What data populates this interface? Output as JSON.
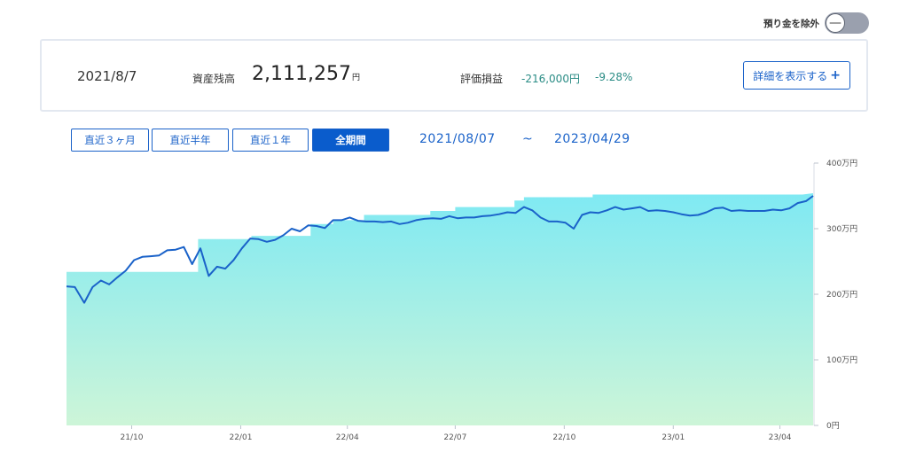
{
  "toggle": {
    "label": "預り金を除外",
    "state": "off",
    "knob_glyph": "—"
  },
  "summary": {
    "date": "2021/8/7",
    "balance_label": "資産残高",
    "balance_value": "2,111,257",
    "balance_unit": "円",
    "eval_label": "評価損益",
    "eval_amount": "-216,000円",
    "eval_percent": "-9.28%",
    "detail_button_label": "詳細を表示する",
    "detail_button_icon": "plus-icon"
  },
  "range_buttons": [
    {
      "label": "直近３ヶ月",
      "active": false
    },
    {
      "label": "直近半年",
      "active": false
    },
    {
      "label": "直近１年",
      "active": false
    },
    {
      "label": "全期間",
      "active": true
    }
  ],
  "period": {
    "start": "2021/08/07",
    "separator": "~",
    "end": "2023/04/29"
  },
  "colors": {
    "accent": "#0a5ccc",
    "line": "#1a62c9",
    "area_top": "#7fe9f3",
    "area_bottom": "#cdf5d8",
    "positive_text": "#2a8c85"
  },
  "chart_data": {
    "type": "area",
    "x_unit": "date",
    "y_ticks": [
      {
        "value": 0,
        "label": "0円"
      },
      {
        "value": 100,
        "label": "100万円"
      },
      {
        "value": 200,
        "label": "200万円"
      },
      {
        "value": 300,
        "label": "300万円"
      },
      {
        "value": 400,
        "label": "400万円"
      }
    ],
    "ylim": [
      0,
      400
    ],
    "x_ticks": [
      {
        "date": "2021-10-01",
        "label": "21/10"
      },
      {
        "date": "2022-01-01",
        "label": "22/01"
      },
      {
        "date": "2022-04-01",
        "label": "22/04"
      },
      {
        "date": "2022-07-01",
        "label": "22/07"
      },
      {
        "date": "2022-10-01",
        "label": "22/10"
      },
      {
        "date": "2023-01-01",
        "label": "23/01"
      },
      {
        "date": "2023-04-01",
        "label": "23/04"
      }
    ],
    "x_range": [
      "2021-08-07",
      "2023-04-29"
    ],
    "series": [
      {
        "role": "area-step",
        "points": [
          [
            "2021-08-07",
            234
          ],
          [
            "2021-11-26",
            234
          ],
          [
            "2021-11-26",
            284
          ],
          [
            "2022-01-10",
            284
          ],
          [
            "2022-01-10",
            289
          ],
          [
            "2022-03-01",
            289
          ],
          [
            "2022-03-01",
            307
          ],
          [
            "2022-03-20",
            307
          ],
          [
            "2022-03-20",
            313
          ],
          [
            "2022-04-15",
            313
          ],
          [
            "2022-04-15",
            321
          ],
          [
            "2022-06-10",
            321
          ],
          [
            "2022-06-10",
            327
          ],
          [
            "2022-07-01",
            327
          ],
          [
            "2022-07-01",
            333
          ],
          [
            "2022-08-20",
            333
          ],
          [
            "2022-08-20",
            343
          ],
          [
            "2022-08-28",
            343
          ],
          [
            "2022-08-28",
            348
          ],
          [
            "2022-10-25",
            348
          ],
          [
            "2022-10-25",
            352
          ],
          [
            "2023-04-20",
            352
          ],
          [
            "2023-04-29",
            354
          ]
        ]
      },
      {
        "role": "line",
        "points": [
          [
            "2021-08-07",
            212
          ],
          [
            "2021-08-14",
            211
          ],
          [
            "2021-08-22",
            187
          ],
          [
            "2021-08-29",
            211
          ],
          [
            "2021-09-05",
            221
          ],
          [
            "2021-09-12",
            215
          ],
          [
            "2021-09-19",
            226
          ],
          [
            "2021-09-26",
            236
          ],
          [
            "2021-10-03",
            252
          ],
          [
            "2021-10-10",
            257
          ],
          [
            "2021-10-17",
            258
          ],
          [
            "2021-10-24",
            259
          ],
          [
            "2021-10-31",
            267
          ],
          [
            "2021-11-07",
            268
          ],
          [
            "2021-11-14",
            272
          ],
          [
            "2021-11-21",
            246
          ],
          [
            "2021-11-28",
            270
          ],
          [
            "2021-12-05",
            228
          ],
          [
            "2021-12-12",
            242
          ],
          [
            "2021-12-19",
            239
          ],
          [
            "2021-12-26",
            252
          ],
          [
            "2022-01-02",
            270
          ],
          [
            "2022-01-09",
            285
          ],
          [
            "2022-01-16",
            284
          ],
          [
            "2022-01-23",
            280
          ],
          [
            "2022-01-30",
            283
          ],
          [
            "2022-02-06",
            290
          ],
          [
            "2022-02-13",
            300
          ],
          [
            "2022-02-20",
            296
          ],
          [
            "2022-02-27",
            305
          ],
          [
            "2022-03-06",
            304
          ],
          [
            "2022-03-13",
            301
          ],
          [
            "2022-03-20",
            313
          ],
          [
            "2022-03-27",
            313
          ],
          [
            "2022-04-03",
            317
          ],
          [
            "2022-04-10",
            312
          ],
          [
            "2022-04-17",
            311
          ],
          [
            "2022-04-24",
            311
          ],
          [
            "2022-05-01",
            310
          ],
          [
            "2022-05-08",
            311
          ],
          [
            "2022-05-15",
            307
          ],
          [
            "2022-05-22",
            309
          ],
          [
            "2022-05-29",
            313
          ],
          [
            "2022-06-05",
            315
          ],
          [
            "2022-06-12",
            316
          ],
          [
            "2022-06-19",
            315
          ],
          [
            "2022-06-26",
            319
          ],
          [
            "2022-07-03",
            316
          ],
          [
            "2022-07-10",
            317
          ],
          [
            "2022-07-17",
            317
          ],
          [
            "2022-07-24",
            319
          ],
          [
            "2022-07-31",
            320
          ],
          [
            "2022-08-07",
            322
          ],
          [
            "2022-08-14",
            325
          ],
          [
            "2022-08-21",
            324
          ],
          [
            "2022-08-28",
            333
          ],
          [
            "2022-09-04",
            328
          ],
          [
            "2022-09-11",
            317
          ],
          [
            "2022-09-18",
            311
          ],
          [
            "2022-09-25",
            311
          ],
          [
            "2022-10-02",
            309
          ],
          [
            "2022-10-09",
            300
          ],
          [
            "2022-10-16",
            321
          ],
          [
            "2022-10-23",
            325
          ],
          [
            "2022-10-30",
            324
          ],
          [
            "2022-11-06",
            328
          ],
          [
            "2022-11-13",
            333
          ],
          [
            "2022-11-20",
            329
          ],
          [
            "2022-11-27",
            331
          ],
          [
            "2022-12-04",
            333
          ],
          [
            "2022-12-11",
            327
          ],
          [
            "2022-12-18",
            328
          ],
          [
            "2022-12-25",
            327
          ],
          [
            "2023-01-01",
            325
          ],
          [
            "2023-01-08",
            322
          ],
          [
            "2023-01-15",
            320
          ],
          [
            "2023-01-22",
            321
          ],
          [
            "2023-01-29",
            325
          ],
          [
            "2023-02-05",
            331
          ],
          [
            "2023-02-12",
            332
          ],
          [
            "2023-02-19",
            327
          ],
          [
            "2023-02-26",
            328
          ],
          [
            "2023-03-05",
            327
          ],
          [
            "2023-03-12",
            327
          ],
          [
            "2023-03-19",
            327
          ],
          [
            "2023-03-26",
            329
          ],
          [
            "2023-04-02",
            328
          ],
          [
            "2023-04-09",
            331
          ],
          [
            "2023-04-16",
            339
          ],
          [
            "2023-04-23",
            342
          ],
          [
            "2023-04-29",
            350
          ]
        ]
      }
    ]
  }
}
